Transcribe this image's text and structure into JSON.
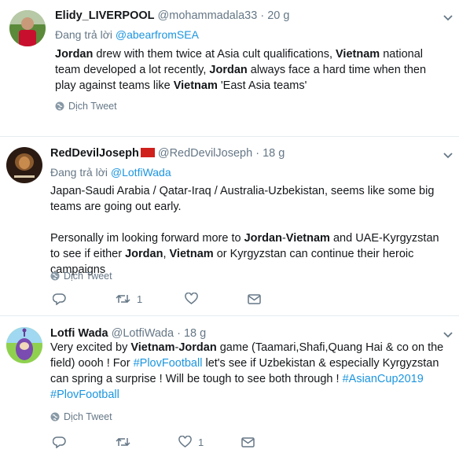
{
  "tweets": [
    {
      "name": "Elidy_LIVERPOOL",
      "handle": "@mohammadala33",
      "separator": "·",
      "time": "20 g",
      "reply_prefix": "Đang trả lời",
      "reply_to": "@abearfromSEA",
      "translate": "Dịch Tweet"
    },
    {
      "name": "RedDevilJoseph",
      "handle": "@RedDevilJoseph",
      "separator": "·",
      "time": "18 g",
      "reply_prefix": "Đang trả lời",
      "reply_to": "@LotfiWada",
      "translate": "Dịch Tweet",
      "retweet_count": "1"
    },
    {
      "name": "Lotfi Wada",
      "handle": "@LotfiWada",
      "separator": "·",
      "time": "18 g",
      "translate": "Dịch Tweet",
      "like_count": "1"
    }
  ],
  "body_text": {
    "t1": {
      "s1": "Jordan",
      "s2": " drew with them twice at Asia cult qualifications, ",
      "s3": "Vietnam",
      "s4": " national team developed a lot recently, ",
      "s5": "Jordan",
      "s6": " always face a hard time when then play against teams like ",
      "s7": "Vietnam",
      "s8": " 'East Asia teams'"
    },
    "t2": {
      "p1": "Japan-Saudi Arabia / Qatar-Iraq / Australia-Uzbekistan, seems like some big teams are going out early.",
      "s1": "Personally im looking forward more to ",
      "s2": "Jordan",
      "s3": "-",
      "s4": "Vietnam",
      "s5": " and UAE-Kyrgyzstan to see if either ",
      "s6": "Jordan",
      "s7": ", ",
      "s8": "Vietnam",
      "s9": " or Kyrgyzstan can continue their heroic campaigns"
    },
    "t3": {
      "s1": "Very excited by ",
      "s2": "Vietnam",
      "s3": "-",
      "s4": "Jordan",
      "s5": " game (Taamari,Shafi,Quang Hai & co on the field) oooh ! For ",
      "s6": "#PlovFootball",
      "s7": " let's see if Uzbekistan & especially Kyrgyzstan can spring a surprise ! Will be tough to see both through ! ",
      "s8": "#AsianCup2019",
      "s9": "#PlovFootball"
    }
  },
  "icons": {
    "reply": "reply-icon",
    "retweet": "retweet-icon",
    "like": "heart-icon",
    "dm": "envelope-icon",
    "translate": "globe-icon",
    "caret": "chevron-down-icon"
  },
  "colors": {
    "link": "#1b95e0",
    "secondary": "#657786",
    "divider": "#e6ecf0"
  }
}
